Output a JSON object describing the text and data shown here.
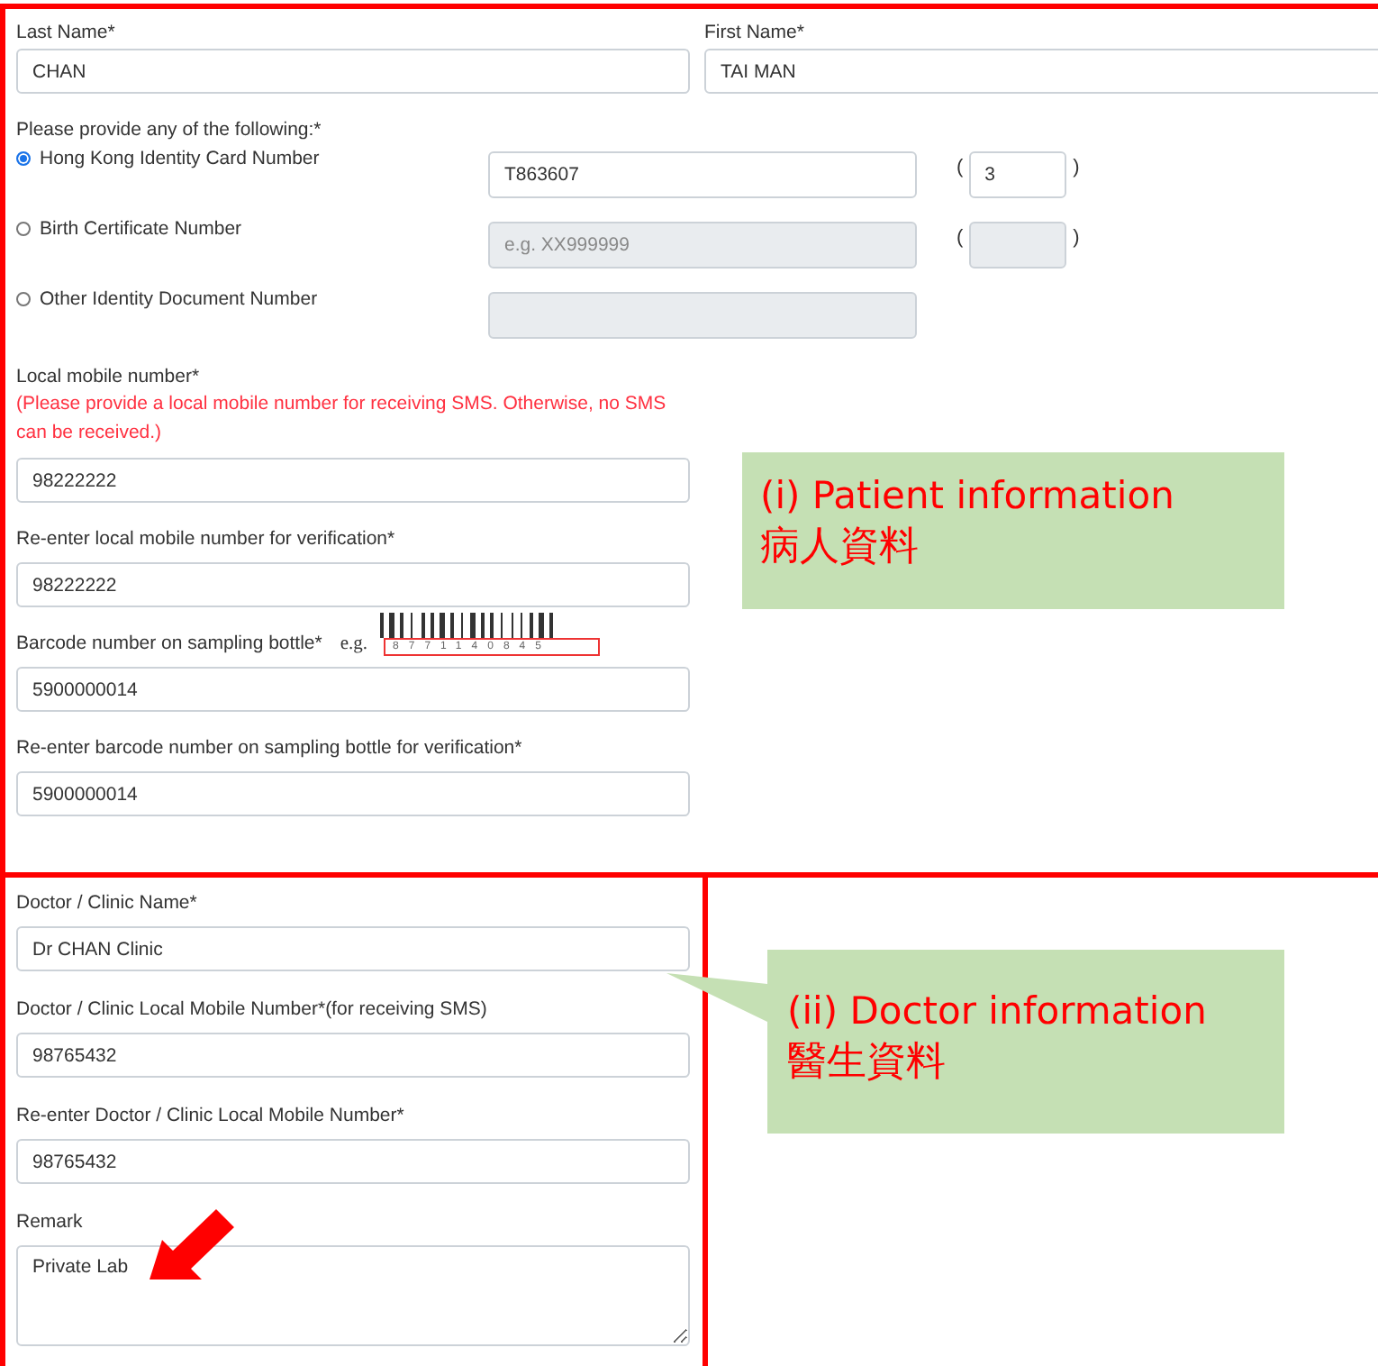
{
  "patient_section": {
    "name_fields": [
      {
        "label": "Last Name*",
        "value": "CHAN"
      },
      {
        "label": "First Name*",
        "value": "TAI MAN"
      }
    ],
    "id_prompt": "Please provide any of the following:*",
    "id_options": [
      {
        "label": "Hong Kong Identity Card Number",
        "selected": true,
        "kind": "with_check",
        "value": "T863607",
        "check_digit": "3",
        "open_paren": "(",
        "close_paren": ")"
      },
      {
        "label": "Birth Certificate Number",
        "selected": false,
        "kind": "with_check",
        "placeholder": "e.g. XX999999",
        "open_paren": "(",
        "close_paren": ")"
      },
      {
        "label": "Other Identity Document Number",
        "selected": false,
        "kind": "plain"
      }
    ],
    "fields": [
      {
        "kind": "text",
        "label": "Local mobile number*",
        "note": "(Please provide a local mobile number for receiving SMS. Otherwise, no SMS can be received.)",
        "value": "98222222"
      },
      {
        "kind": "text",
        "label": "Re-enter local mobile number for verification*",
        "value": "98222222"
      },
      {
        "kind": "barcode",
        "label": "Barcode number on sampling bottle*",
        "example_label": "e.g.",
        "example_digits": "8771140845",
        "value": "5900000014"
      },
      {
        "kind": "text",
        "label": "Re-enter barcode number on sampling bottle for verification*",
        "value": "5900000014"
      }
    ]
  },
  "doctor_section": {
    "fields": [
      {
        "kind": "text",
        "label": "Doctor / Clinic Name*",
        "value": "Dr CHAN Clinic"
      },
      {
        "kind": "text",
        "label": "Doctor / Clinic Local Mobile Number*(for receiving SMS)",
        "value": "98765432"
      },
      {
        "kind": "text",
        "label": "Re-enter Doctor / Clinic Local Mobile Number*",
        "value": "98765432"
      },
      {
        "kind": "textarea",
        "label": "Remark",
        "value": "Private Lab"
      }
    ]
  },
  "callouts": [
    {
      "title": "(i) Patient information",
      "subtitle": "病人資料"
    },
    {
      "title": "(ii) Doctor information",
      "subtitle": "醫生資料"
    }
  ]
}
